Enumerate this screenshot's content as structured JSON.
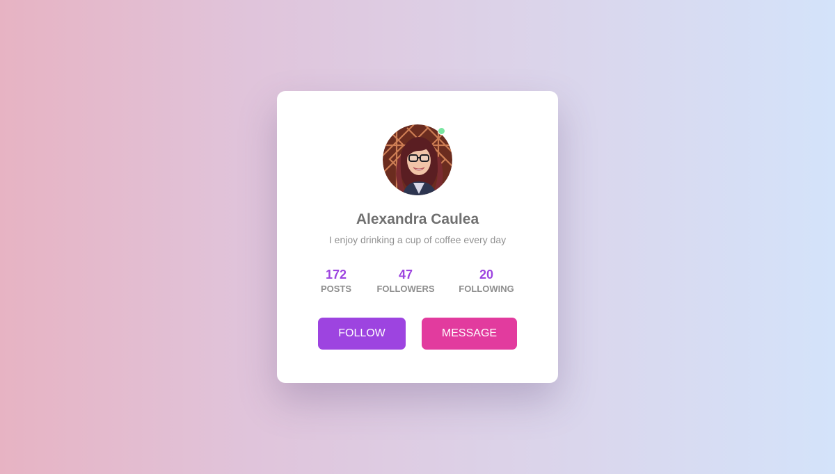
{
  "profile": {
    "name": "Alexandra Caulea",
    "bio": "I enjoy drinking a cup of coffee every day",
    "online": true
  },
  "stats": [
    {
      "value": "172",
      "label": "POSTS"
    },
    {
      "value": "47",
      "label": "FOLLOWERS"
    },
    {
      "value": "20",
      "label": "FOLLOWING"
    }
  ],
  "actions": {
    "follow_label": "FOLLOW",
    "message_label": "MESSAGE"
  },
  "colors": {
    "accent_purple": "#9d44e0",
    "accent_pink": "#e23b9e",
    "online_green": "#7ae6a2"
  }
}
